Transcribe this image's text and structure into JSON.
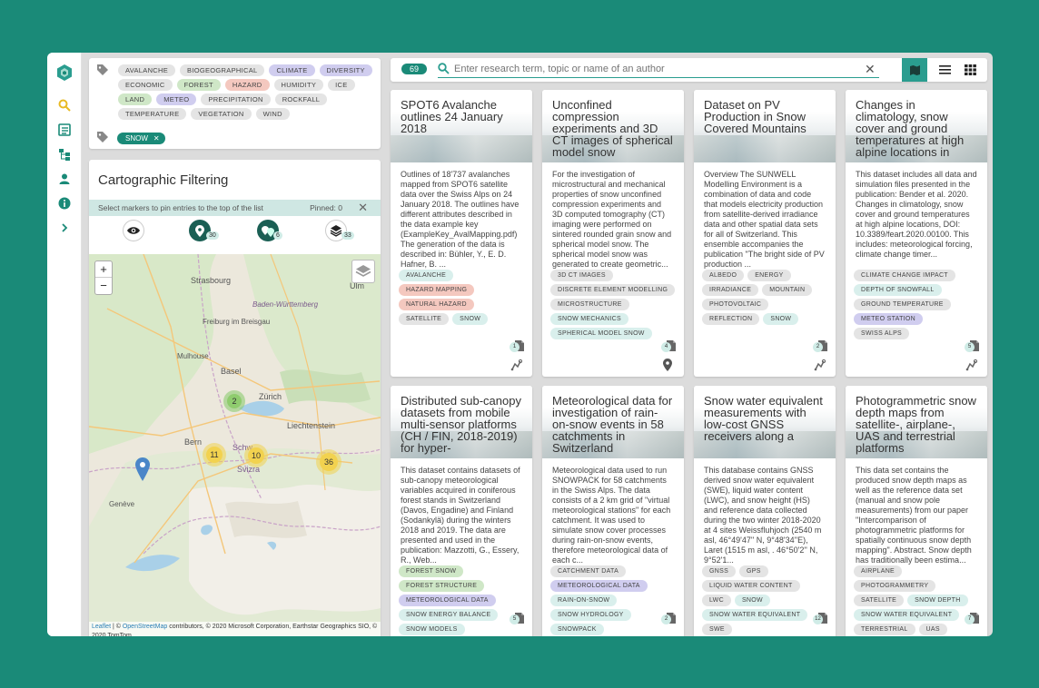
{
  "tags": {
    "available": [
      {
        "label": "AVALANCHE",
        "tone": "grey"
      },
      {
        "label": "BIOGEOGRAPHICAL",
        "tone": "grey"
      },
      {
        "label": "CLIMATE",
        "tone": "purple"
      },
      {
        "label": "DIVERSITY",
        "tone": "purple"
      },
      {
        "label": "ECONOMIC",
        "tone": "grey"
      },
      {
        "label": "FOREST",
        "tone": "green"
      },
      {
        "label": "HAZARD",
        "tone": "red"
      },
      {
        "label": "HUMIDITY",
        "tone": "grey"
      },
      {
        "label": "ICE",
        "tone": "grey"
      },
      {
        "label": "LAND",
        "tone": "green"
      },
      {
        "label": "METEO",
        "tone": "purple"
      },
      {
        "label": "PRECIPITATION",
        "tone": "grey"
      },
      {
        "label": "ROCKFALL",
        "tone": "grey"
      },
      {
        "label": "TEMPERATURE",
        "tone": "grey"
      },
      {
        "label": "VEGETATION",
        "tone": "grey"
      },
      {
        "label": "WIND",
        "tone": "grey"
      }
    ],
    "selected": "SNOW"
  },
  "carto": {
    "title": "Cartographic Filtering",
    "pin_hint": "Select markers to pin entries to the top of the list",
    "pinned_label": "Pinned: 0",
    "counts": {
      "markers": "30",
      "multi": "6",
      "layers": "33"
    },
    "clusters": [
      {
        "label": "2",
        "color": "green"
      },
      {
        "label": "11",
        "color": "yellow"
      },
      {
        "label": "10",
        "color": "yellow"
      },
      {
        "label": "36",
        "color": "yellow"
      }
    ],
    "places": [
      "Strasbourg",
      "Freiburg im Breisgau",
      "Baden-Württemberg",
      "Ulm",
      "Mulhouse",
      "Basel",
      "Zürich",
      "Bern",
      "Liechtenstein",
      "Genève",
      "Svizra",
      "Schw"
    ],
    "zoom_in": "+",
    "zoom_out": "−",
    "attribution_leaflet": "Leaflet",
    "attribution_osm": "OpenStreetMap",
    "attribution_rest": " contributors, © 2020 Microsoft Corporation, Earthstar Geographics SIO, © 2020 TomTom",
    "attribution_prefix": " | © "
  },
  "search": {
    "count": "69",
    "placeholder": "Enter research term, topic or name of an author"
  },
  "colors": {
    "accent": "#1a8a78",
    "accent_light": "#2a9d8f",
    "background": "#dcdcdc"
  },
  "cards": [
    {
      "title": "SPOT6 Avalanche outlines 24 January 2018",
      "desc": "Outlines of 18'737 avalanches mapped from SPOT6 satellite data over the Swiss Alps on 24 January 2018. The outlines have different attributes described in the data example key (ExampleKey_AvalMapping.pdf) The generation of the data is described in: Bühler, Y., E. D. Hafner, B. ...",
      "tags": [
        [
          "AVALANCHE",
          "teal"
        ],
        [
          "HAZARD MAPPING",
          "red"
        ],
        [
          "NATURAL HAZARD",
          "red"
        ],
        [
          "SATELLITE",
          "grey"
        ],
        [
          "SNOW",
          "teal"
        ]
      ],
      "docs": "1"
    },
    {
      "title": "Unconfined compression experiments and 3D CT images of spherical model snow",
      "desc": "For the investigation of microstructural and mechanical properties of snow unconfined compression experiments and 3D computed tomography (CT) imaging were performed on sintered rounded grain snow and spherical model snow. The spherical model snow was generated to create geometric...",
      "tags": [
        [
          "3D CT IMAGES",
          "grey"
        ],
        [
          "DISCRETE ELEMENT MODELLING",
          "grey"
        ],
        [
          "MICROSTRUCTURE",
          "grey"
        ],
        [
          "SNOW MECHANICS",
          "teal"
        ],
        [
          "SPHERICAL MODEL SNOW",
          "teal"
        ]
      ],
      "docs": "4"
    },
    {
      "title": "Dataset on PV Production in Snow Covered Mountains",
      "desc": "Overview The SUNWELL Modelling Environment is a combination of data and code that models electricity production from satellite-derived irradiance data and other spatial data sets for all of Switzerland. This ensemble accompanies the publication \"The bright side of PV production ...",
      "tags": [
        [
          "ALBEDO",
          "grey"
        ],
        [
          "ENERGY",
          "grey"
        ],
        [
          "IRRADIANCE",
          "grey"
        ],
        [
          "MOUNTAIN",
          "grey"
        ],
        [
          "PHOTOVOLTAIC",
          "grey"
        ],
        [
          "REFLECTION",
          "grey"
        ],
        [
          "SNOW",
          "teal"
        ]
      ],
      "docs": "2"
    },
    {
      "title": "Changes in climatology, snow cover and ground temperatures at high alpine locations in",
      "desc": "This dataset includes all data and simulation files presented in the publication: Bender et al. 2020. Changes in climatology, snow cover and ground temperatures at high alpine locations, DOI: 10.3389/feart.2020.00100. This includes: meteorological forcing, climate change timer...",
      "tags": [
        [
          "CLIMATE CHANGE IMPACT",
          "grey"
        ],
        [
          "DEPTH OF SNOWFALL",
          "teal"
        ],
        [
          "GROUND TEMPERATURE",
          "grey"
        ],
        [
          "METEO STATION",
          "purple"
        ],
        [
          "SWISS ALPS",
          "grey"
        ]
      ],
      "docs": "5"
    },
    {
      "title": "Distributed sub-canopy datasets from mobile multi-sensor platforms (CH / FIN, 2018-2019) for hyper-",
      "desc": "This dataset contains datasets of sub-canopy meteorological variables acquired in coniferous forest stands in Switzerland (Davos, Engadine) and Finland (Sodankylä) during the winters 2018 and 2019. The data are presented and used in the publication: Mazzotti, G., Essery, R., Web...",
      "tags": [
        [
          "FOREST SNOW",
          "green"
        ],
        [
          "FOREST STRUCTURE",
          "green"
        ],
        [
          "METEOROLOGICAL DATA",
          "purple"
        ],
        [
          "SNOW ENERGY BALANCE",
          "teal"
        ],
        [
          "SNOW MODELS",
          "teal"
        ]
      ],
      "docs": "5"
    },
    {
      "title": "Meteorological data for investigation of rain-on-snow events in 58 catchments in Switzerland",
      "desc": "Meteorological data used to run SNOWPACK for 58 catchments in the Swiss Alps. The data consists of a 2 km grid of \"virtual meteorological stations\" for each catchment. It was used to simulate snow cover processes during rain-on-snow events, therefore meteorological data of each c...",
      "tags": [
        [
          "CATCHMENT DATA",
          "grey"
        ],
        [
          "METEOROLOGICAL DATA",
          "purple"
        ],
        [
          "RAIN-ON-SNOW",
          "teal"
        ],
        [
          "SNOW HYDROLOGY",
          "teal"
        ],
        [
          "SNOWPACK",
          "teal"
        ]
      ],
      "docs": "2"
    },
    {
      "title": "Snow water equivalent measurements with low-cost GNSS receivers along a",
      "desc": "This database contains GNSS derived snow water equivalent (SWE), liquid water content (LWC), and snow height (HS) and reference data collected during the two winter 2018-2020 at 4 sites Weissfluhjoch (2540 m asl, 46°49'47'' N, 9°48'34''E), Laret (1515 m asl, . 46°50'2'' N, 9°52'1...",
      "tags": [
        [
          "GNSS",
          "grey"
        ],
        [
          "GPS",
          "grey"
        ],
        [
          "LIQUID WATER CONTENT",
          "grey"
        ],
        [
          "LWC",
          "grey"
        ],
        [
          "SNOW",
          "teal"
        ],
        [
          "SNOW WATER EQUIVALENT",
          "teal"
        ],
        [
          "SWE",
          "grey"
        ]
      ],
      "docs": "12"
    },
    {
      "title": "Photogrammetric snow depth maps from satellite-, airplane-, UAS and terrestrial platforms",
      "desc": "This data set contains the produced snow depth maps as well as the reference data set (manual and snow pole measurements) from our paper \"Intercomparison of photogrammetric platforms for spatially continuous snow depth mapping\". Abstract. Snow depth has traditionally been estima...",
      "tags": [
        [
          "AIRPLANE",
          "grey"
        ],
        [
          "PHOTOGRAMMETRY",
          "grey"
        ],
        [
          "SATELLITE",
          "grey"
        ],
        [
          "SNOW DEPTH",
          "teal"
        ],
        [
          "SNOW WATER EQUIVALENT",
          "teal"
        ],
        [
          "TERRESTRIAL",
          "grey"
        ],
        [
          "UAS",
          "grey"
        ]
      ],
      "docs": "7"
    }
  ]
}
